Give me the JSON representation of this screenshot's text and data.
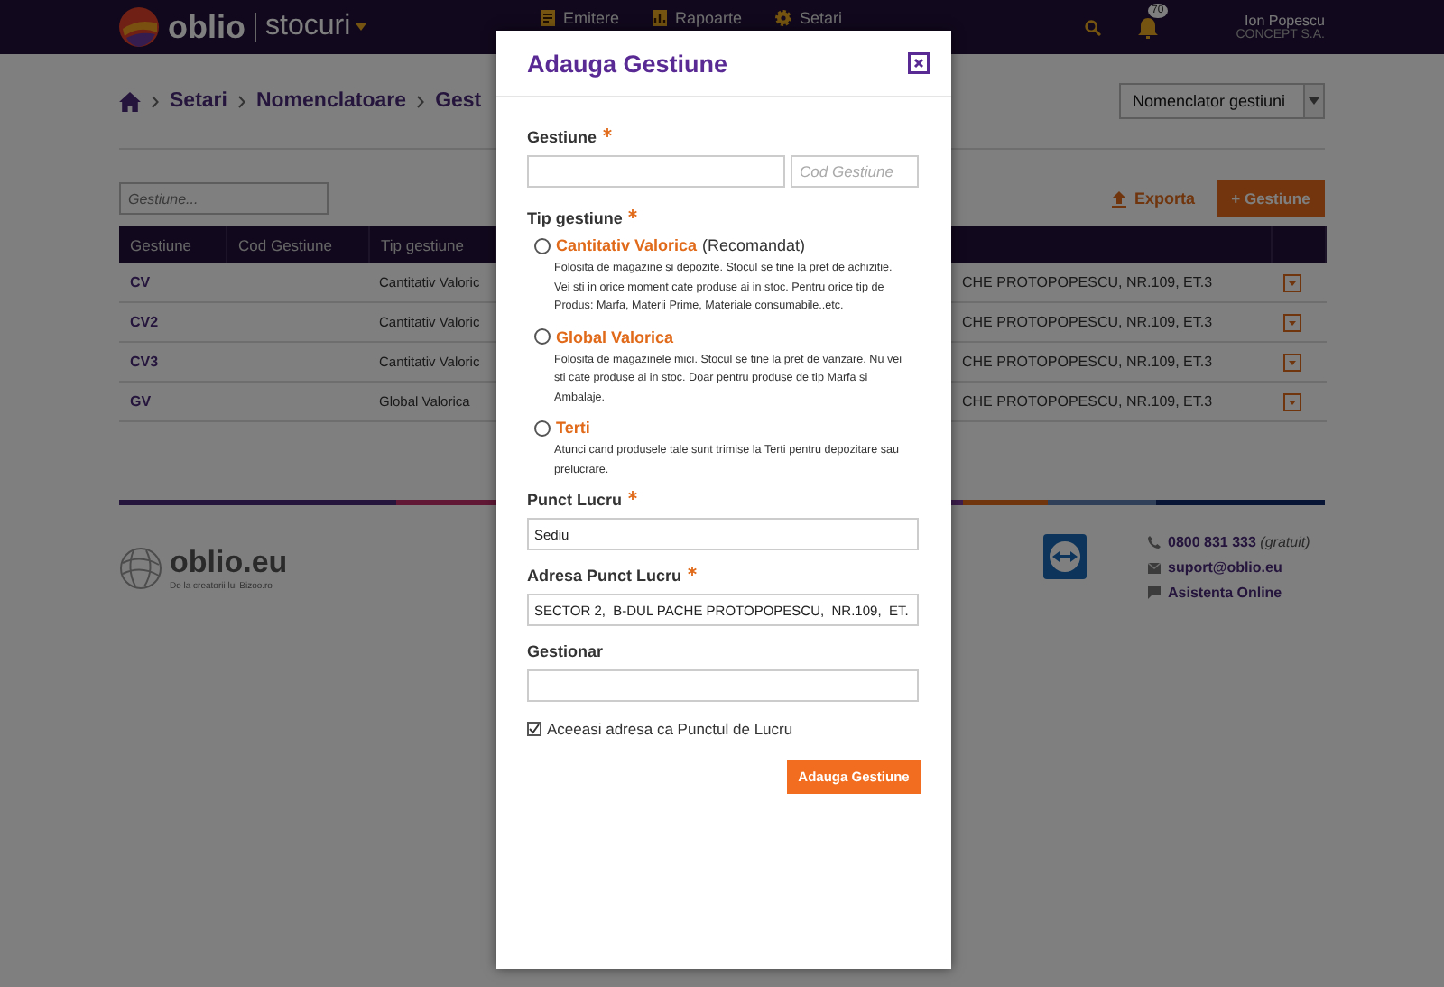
{
  "header": {
    "brand": "oblio",
    "product": "stocuri",
    "menu": [
      {
        "label": "Emitere",
        "kind": "doc"
      },
      {
        "label": "Rapoarte",
        "kind": "report"
      },
      {
        "label": "Setari",
        "kind": "gear"
      }
    ],
    "notifications": "70",
    "user": {
      "name": "Ion Popescu",
      "company": "CONCEPT S.A."
    }
  },
  "breadcrumb": [
    "Setari",
    "Nomenclatoare",
    "Gest"
  ],
  "view_select": {
    "value": "Nomenclator gestiuni"
  },
  "search": {
    "placeholder": "Gestiune..."
  },
  "actions": {
    "export": "Exporta",
    "add": "+ Gestiune"
  },
  "table": {
    "columns": [
      "Gestiune",
      "Cod Gestiune",
      "Tip gestiune"
    ],
    "rows": [
      {
        "gestiune": "CV",
        "tip": "Cantitativ Valoric",
        "address": "CHE PROTOPOPESCU, NR.109, ET.3"
      },
      {
        "gestiune": "CV2",
        "tip": "Cantitativ Valoric",
        "address": "CHE PROTOPOPESCU, NR.109, ET.3"
      },
      {
        "gestiune": "CV3",
        "tip": "Cantitativ Valoric",
        "address": "CHE PROTOPOPESCU, NR.109, ET.3"
      },
      {
        "gestiune": "GV",
        "tip": "Global Valorica",
        "address": "CHE PROTOPOPESCU, NR.109, ET.3"
      }
    ]
  },
  "footer": {
    "logo": "oblio.eu",
    "tagline": "De la creatorii lui Bizoo.ro",
    "phone": "0800 831 333",
    "phone_note": "(gratuit)",
    "email": "suport@oblio.eu",
    "chat": "Asistenta Online"
  },
  "dialog": {
    "title": "Adauga Gestiune",
    "gestiune": {
      "label": "Gestiune",
      "required": true,
      "code_placeholder": "Cod Gestiune"
    },
    "tip": {
      "label": "Tip gestiune",
      "required": true,
      "options": [
        {
          "name": "Cantitativ Valorica",
          "note": "(Recomandat)",
          "selected": false,
          "description": "Folosita de magazine si depozite. Stocul se tine la pret de achizitie. Vei sti in orice moment cate produse ai in stoc. Pentru orice tip de Produs: Marfa, Materii Prime, Materiale consumabile..etc."
        },
        {
          "name": "Global Valorica",
          "selected": false,
          "description": "Folosita de magazinele mici. Stocul se tine la pret de vanzare. Nu vei sti cate produse ai in stoc. Doar pentru produse de tip Marfa si Ambalaje."
        },
        {
          "name": "Terti",
          "selected": false,
          "description": "Atunci cand produsele tale sunt trimise la Terti pentru depozitare sau prelucrare."
        }
      ]
    },
    "fields": [
      {
        "label": "Punct Lucru",
        "required": true,
        "value": "Sediu"
      },
      {
        "label": "Adresa Punct Lucru",
        "required": true,
        "value": "SECTOR 2,  B-DUL PACHE PROTOPOPESCU,  NR.109,  ET."
      },
      {
        "label": "Gestionar",
        "required": false
      }
    ],
    "same_address": {
      "label": "Aceeasi adresa ca Punctul de Lucru",
      "checked": true
    },
    "submit": "Adauga Gestiune"
  }
}
